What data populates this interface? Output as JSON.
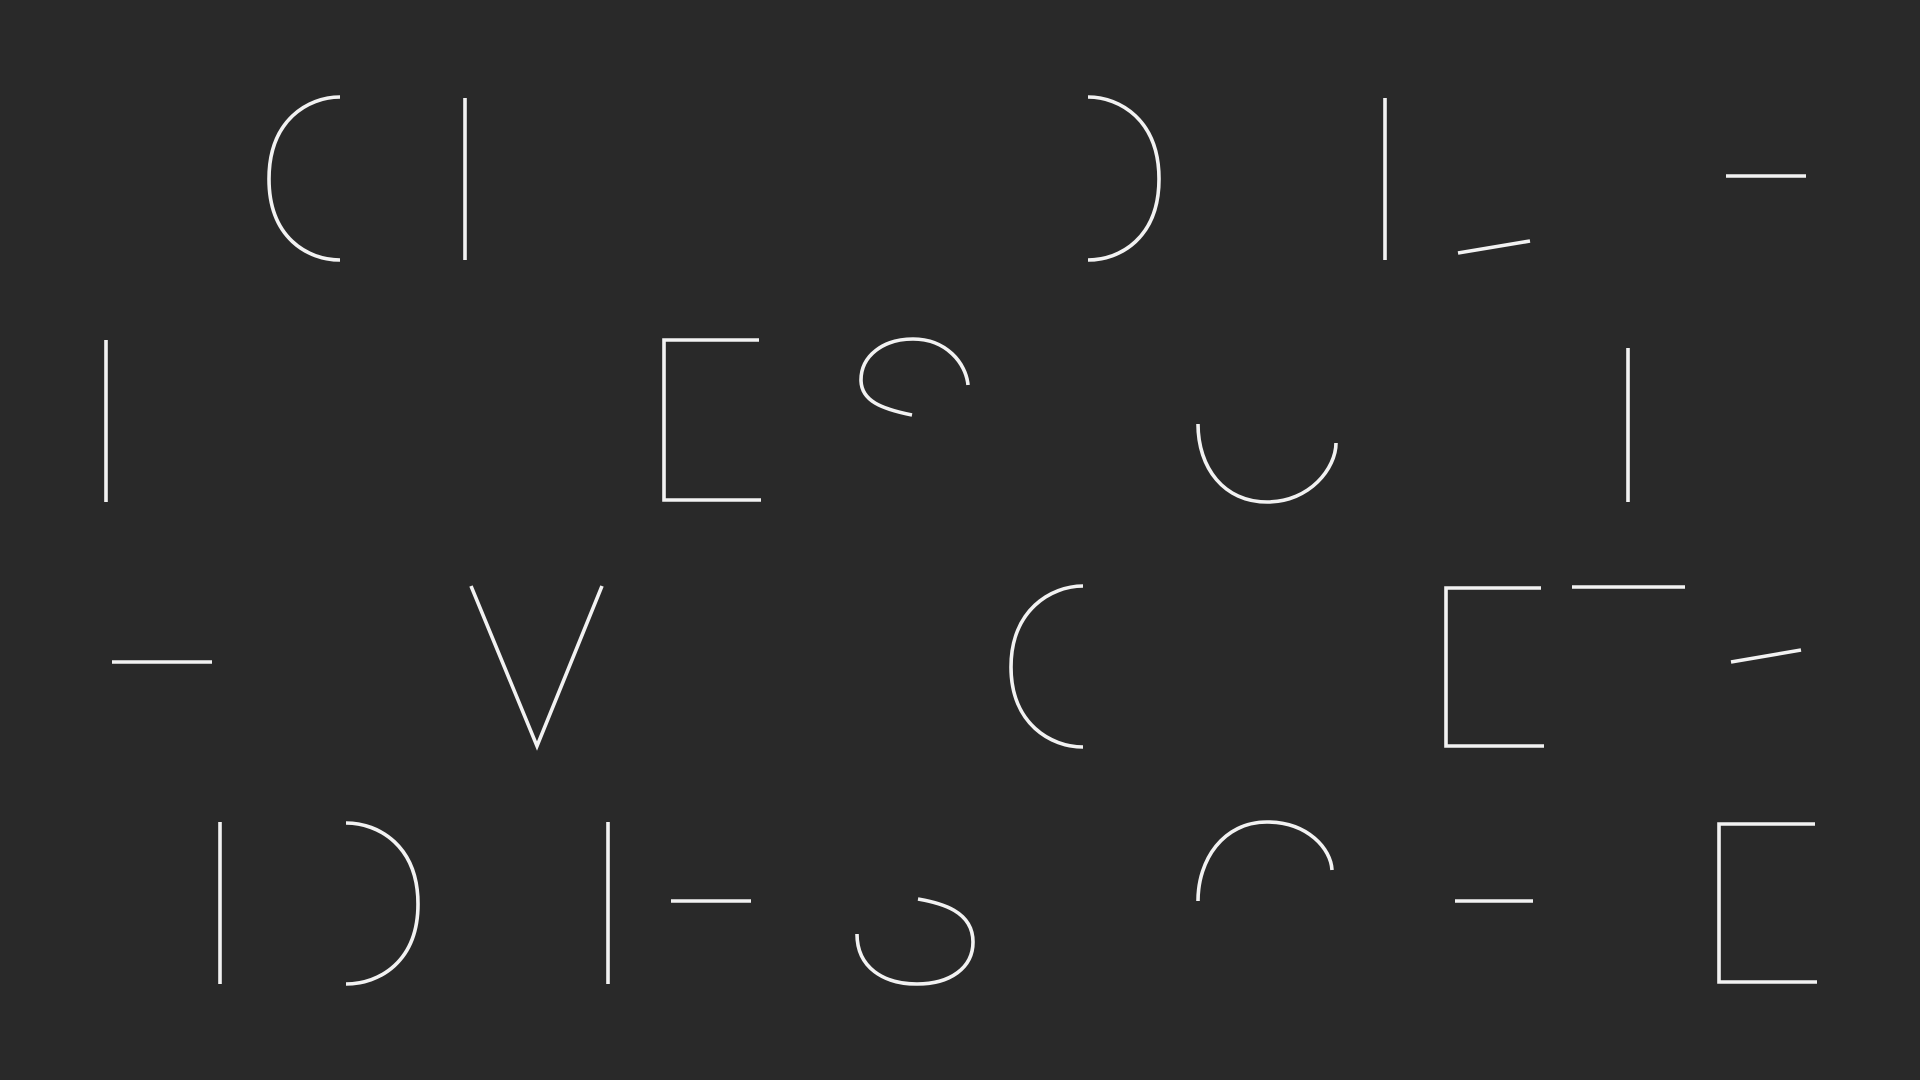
{
  "colors": {
    "background": "#292929",
    "stroke": "#f2f2f2"
  },
  "glyph_fragments": [
    {
      "name": "left-arc-fragment"
    },
    {
      "name": "vertical-stroke-fragment"
    },
    {
      "name": "right-arc-fragment"
    },
    {
      "name": "vertical-stroke-fragment"
    },
    {
      "name": "slanted-stroke-fragment"
    },
    {
      "name": "horizontal-stroke-fragment"
    },
    {
      "name": "vertical-stroke-fragment"
    },
    {
      "name": "e-bracket-fragment"
    },
    {
      "name": "s-top-loop-fragment"
    },
    {
      "name": "u-bowl-fragment"
    },
    {
      "name": "vertical-stroke-fragment"
    },
    {
      "name": "horizontal-stroke-fragment"
    },
    {
      "name": "v-glyph-fragment"
    },
    {
      "name": "left-arc-fragment"
    },
    {
      "name": "e-bracket-fragment"
    },
    {
      "name": "horizontal-stroke-fragment"
    },
    {
      "name": "slanted-stroke-fragment"
    },
    {
      "name": "vertical-stroke-fragment"
    },
    {
      "name": "right-arc-fragment"
    },
    {
      "name": "vertical-stroke-fragment"
    },
    {
      "name": "horizontal-stroke-fragment"
    },
    {
      "name": "s-bottom-loop-fragment"
    },
    {
      "name": "top-arch-fragment"
    },
    {
      "name": "horizontal-stroke-fragment"
    },
    {
      "name": "e-bracket-fragment"
    }
  ]
}
